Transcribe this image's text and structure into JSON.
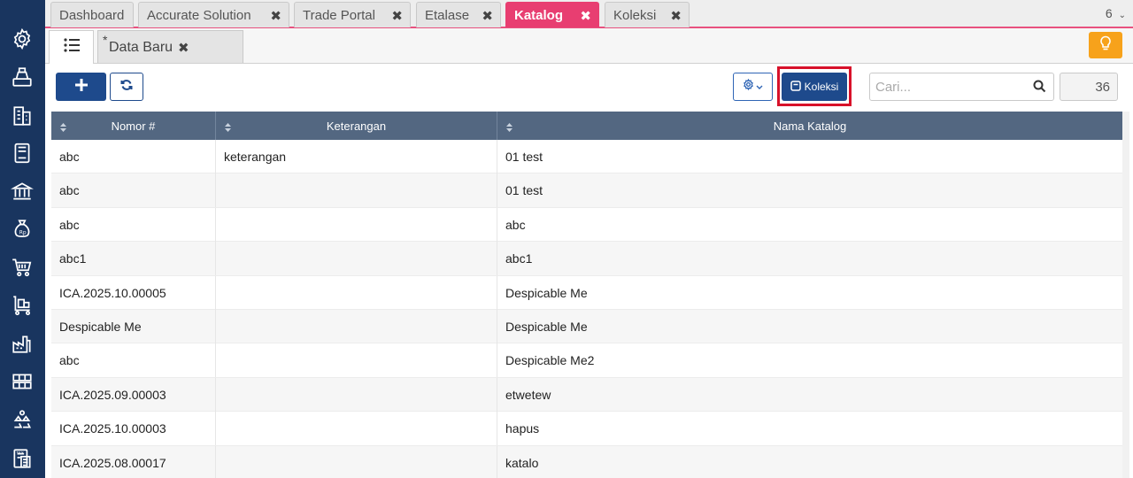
{
  "tabs": [
    {
      "label": "Dashboard",
      "closable": false
    },
    {
      "label": "Accurate Solution",
      "closable": true
    },
    {
      "label": "Trade Portal",
      "closable": true
    },
    {
      "label": "Etalase",
      "closable": true
    },
    {
      "label": "Katalog",
      "closable": true,
      "active": true
    },
    {
      "label": "Koleksi",
      "closable": true
    }
  ],
  "tab_count": "6",
  "subtabs": {
    "new_marker": "*",
    "new_label": "Data Baru"
  },
  "toolbar": {
    "koleksi_label": "Koleksi",
    "search_placeholder": "Cari...",
    "record_count": "36"
  },
  "table": {
    "columns": [
      "Nomor #",
      "Keterangan",
      "Nama Katalog"
    ],
    "rows": [
      {
        "nomor": "abc",
        "keterangan": "keterangan",
        "nama": "01 test"
      },
      {
        "nomor": "abc",
        "keterangan": "",
        "nama": "01 test"
      },
      {
        "nomor": "abc",
        "keterangan": "",
        "nama": "abc"
      },
      {
        "nomor": "abc1",
        "keterangan": "",
        "nama": "abc1"
      },
      {
        "nomor": "ICA.2025.10.00005",
        "keterangan": "",
        "nama": "Despicable Me"
      },
      {
        "nomor": "Despicable Me",
        "keterangan": "",
        "nama": "Despicable Me"
      },
      {
        "nomor": "abc",
        "keterangan": "",
        "nama": "Despicable Me2"
      },
      {
        "nomor": "ICA.2025.09.00003",
        "keterangan": "",
        "nama": "etwetew"
      },
      {
        "nomor": "ICA.2025.10.00003",
        "keterangan": "",
        "nama": "hapus"
      },
      {
        "nomor": "ICA.2025.08.00017",
        "keterangan": "",
        "nama": "katalo"
      }
    ]
  },
  "sidebar_icons": [
    "settings-gear-icon",
    "cashier-icon",
    "company-building-icon",
    "book-icon",
    "bank-icon",
    "money-bag-icon",
    "shopping-cart-icon",
    "delivery-cart-icon",
    "factory-icon",
    "warehouse-icon",
    "recycle-icon",
    "tax-document-icon"
  ],
  "colors": {
    "sidebar": "#19355f",
    "active_tab": "#e83e71",
    "primary_button": "#1e4a8c",
    "table_header": "#536781",
    "highlight": "#d8112a",
    "tips_button": "#f7a21b"
  }
}
